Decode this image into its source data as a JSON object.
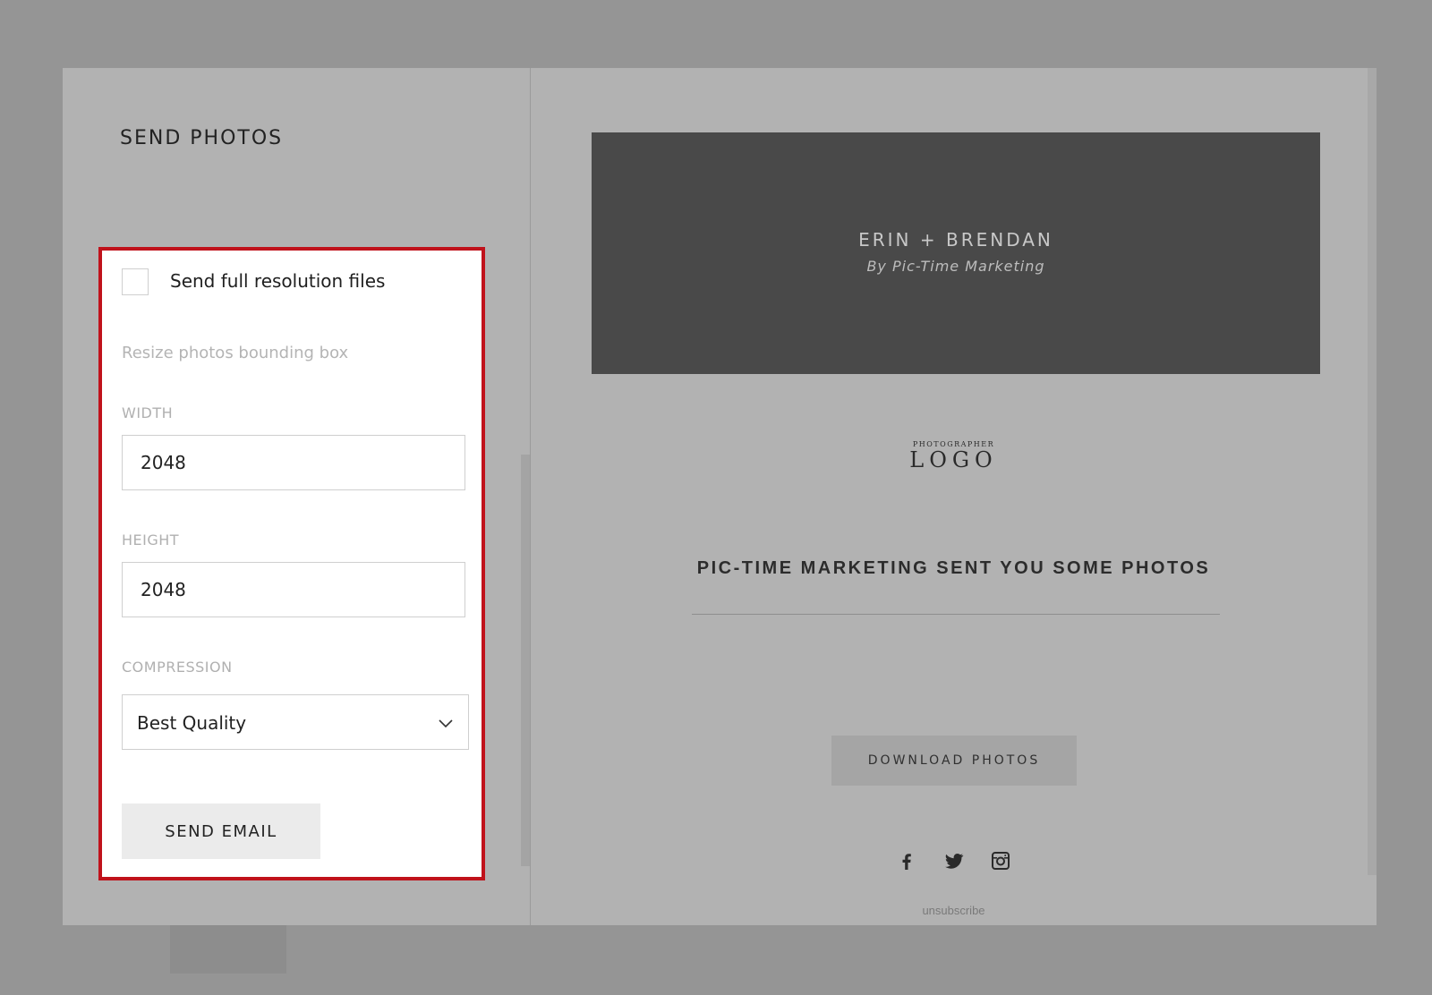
{
  "dialog": {
    "title": "SEND PHOTOS",
    "full_resolution_label": "Send full resolution files",
    "full_resolution_checked": false,
    "resize_label": "Resize photos bounding box",
    "width_label": "WIDTH",
    "width_value": "2048",
    "height_label": "HEIGHT",
    "height_value": "2048",
    "compression_label": "COMPRESSION",
    "compression_value": "Best Quality",
    "send_button": "SEND EMAIL"
  },
  "preview": {
    "hero_title": "ERIN + BRENDAN",
    "hero_subtitle": "By Pic-Time Marketing",
    "logo_small": "PHOTOGRAPHER",
    "logo_big": "LOGO",
    "headline": "PIC-TIME MARKETING SENT YOU SOME PHOTOS",
    "download_button": "DOWNLOAD PHOTOS",
    "social_icons": [
      "facebook-icon",
      "twitter-icon",
      "instagram-icon"
    ],
    "unsubscribe": "unsubscribe"
  },
  "colors": {
    "highlight_border": "#c0121b",
    "overlay": "#959595",
    "hero_bg": "#494949"
  }
}
